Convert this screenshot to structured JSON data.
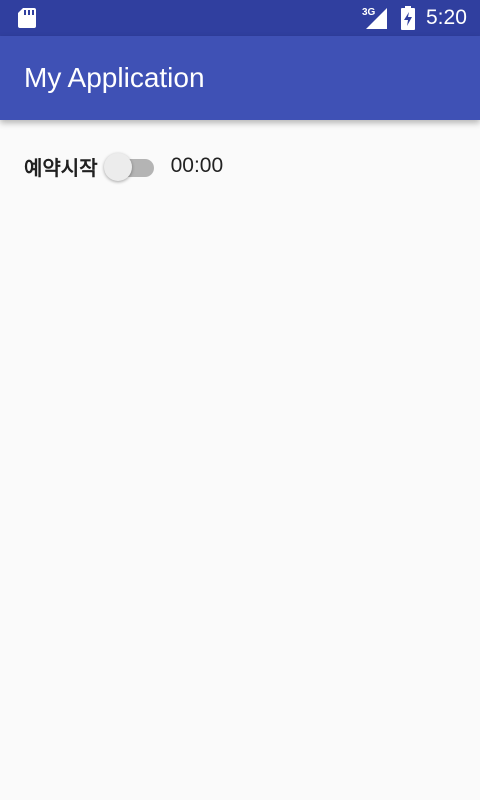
{
  "status_bar": {
    "network_label": "3G",
    "time": "5:20",
    "icons": [
      "sd-card-icon",
      "signal-icon",
      "battery-charging-icon"
    ],
    "background": "#303f9f"
  },
  "app_bar": {
    "title": "My Application",
    "background": "#3f51b5"
  },
  "content": {
    "switch_label": "예약시작",
    "switch_on": false,
    "time_value": "00:00"
  }
}
